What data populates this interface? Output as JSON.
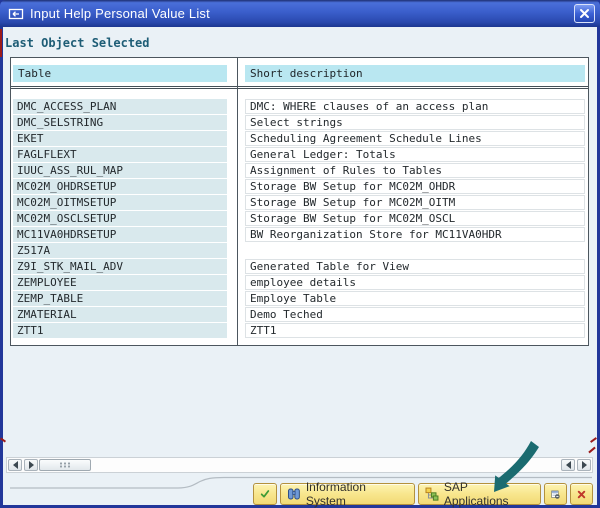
{
  "window": {
    "title": "Input Help Personal Value List"
  },
  "section": {
    "label": "Last Object Selected"
  },
  "table": {
    "columns": [
      {
        "label": "Table"
      },
      {
        "label": "Short description"
      }
    ],
    "rows": [
      {
        "table": "DMC_ACCESS_PLAN",
        "desc": "DMC: WHERE clauses of an access plan"
      },
      {
        "table": "DMC_SELSTRING",
        "desc": "Select strings"
      },
      {
        "table": "EKET",
        "desc": "Scheduling Agreement Schedule Lines"
      },
      {
        "table": "FAGLFLEXT",
        "desc": "General Ledger: Totals"
      },
      {
        "table": "IUUC_ASS_RUL_MAP",
        "desc": "Assignment of Rules to Tables"
      },
      {
        "table": "MC02M_OHDRSETUP",
        "desc": "Storage BW Setup for MC02M_OHDR"
      },
      {
        "table": "MC02M_OITMSETUP",
        "desc": "Storage BW Setup for MC02M_OITM"
      },
      {
        "table": "MC02M_OSCLSETUP",
        "desc": "Storage BW Setup for MC02M_OSCL"
      },
      {
        "table": "MC11VA0HDRSETUP",
        "desc": "BW Reorganization Store for MC11VA0HDR"
      },
      {
        "table": "Z517A",
        "desc": ""
      },
      {
        "table": "Z9I_STK_MAIL_ADV",
        "desc": "Generated Table for View"
      },
      {
        "table": "ZEMPLOYEE",
        "desc": "employee details"
      },
      {
        "table": "ZEMP_TABLE",
        "desc": "Employe Table"
      },
      {
        "table": "ZMATERIAL",
        "desc": "Demo Teched"
      },
      {
        "table": "ZTT1",
        "desc": "ZTT1"
      }
    ]
  },
  "footer": {
    "buttons": {
      "confirm": {
        "icon": "green-check"
      },
      "information_system": {
        "label": "Information System",
        "icon": "binoculars"
      },
      "sap_applications": {
        "label": "SAP Applications",
        "icon": "hierarchy"
      },
      "personal_value_list": {
        "icon": "list-minus"
      },
      "cancel": {
        "icon": "red-x"
      }
    }
  },
  "colors": {
    "titlebar": "#2b50b8",
    "header_fill": "#b9e7f1",
    "row_fill": "#d9e9ed",
    "button_fill": "#f7e388",
    "annotation_arrow": "#1a6b70",
    "annotation_mark": "#9c1b1b"
  }
}
